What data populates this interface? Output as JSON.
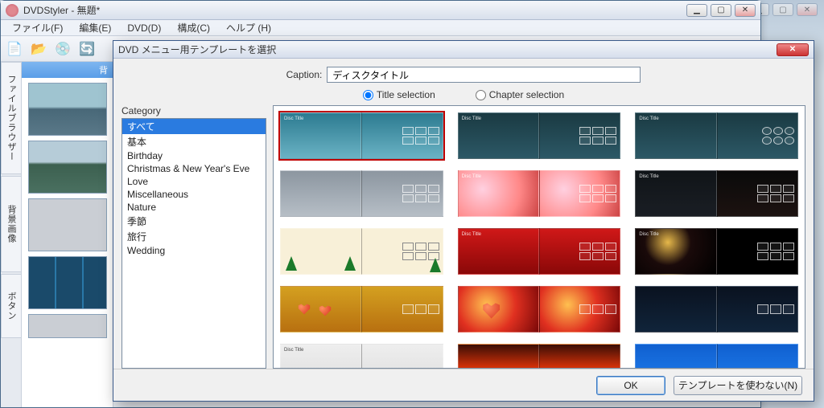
{
  "window": {
    "title": "DVDStyler - 無題*",
    "menu": {
      "file": "ファイル(F)",
      "edit": "編集(E)",
      "dvd": "DVD(D)",
      "config": "構成(C)",
      "help": "ヘルプ (H)"
    },
    "win_min": "▁",
    "win_max": "▢",
    "win_close": "✕"
  },
  "side_tabs": {
    "file_browser": "ファイルブラウザー",
    "background": "背景画像",
    "buttons": "ボタン"
  },
  "fb_header": "背",
  "dialog": {
    "title": "DVD メニュー用テンプレートを選択",
    "caption_label": "Caption:",
    "caption_value": "ディスクタイトル",
    "radio_title": "Title selection",
    "radio_chapter": "Chapter selection",
    "category_label": "Category",
    "categories": [
      "すべて",
      "基本",
      "Birthday",
      "Christmas & New Year's Eve",
      "Love",
      "Miscellaneous",
      "Nature",
      "季節",
      "旅行",
      "Wedding"
    ],
    "ok": "OK",
    "no_template": "テンプレートを使わない(N)",
    "tpl_disc_title": "Disc Title"
  }
}
